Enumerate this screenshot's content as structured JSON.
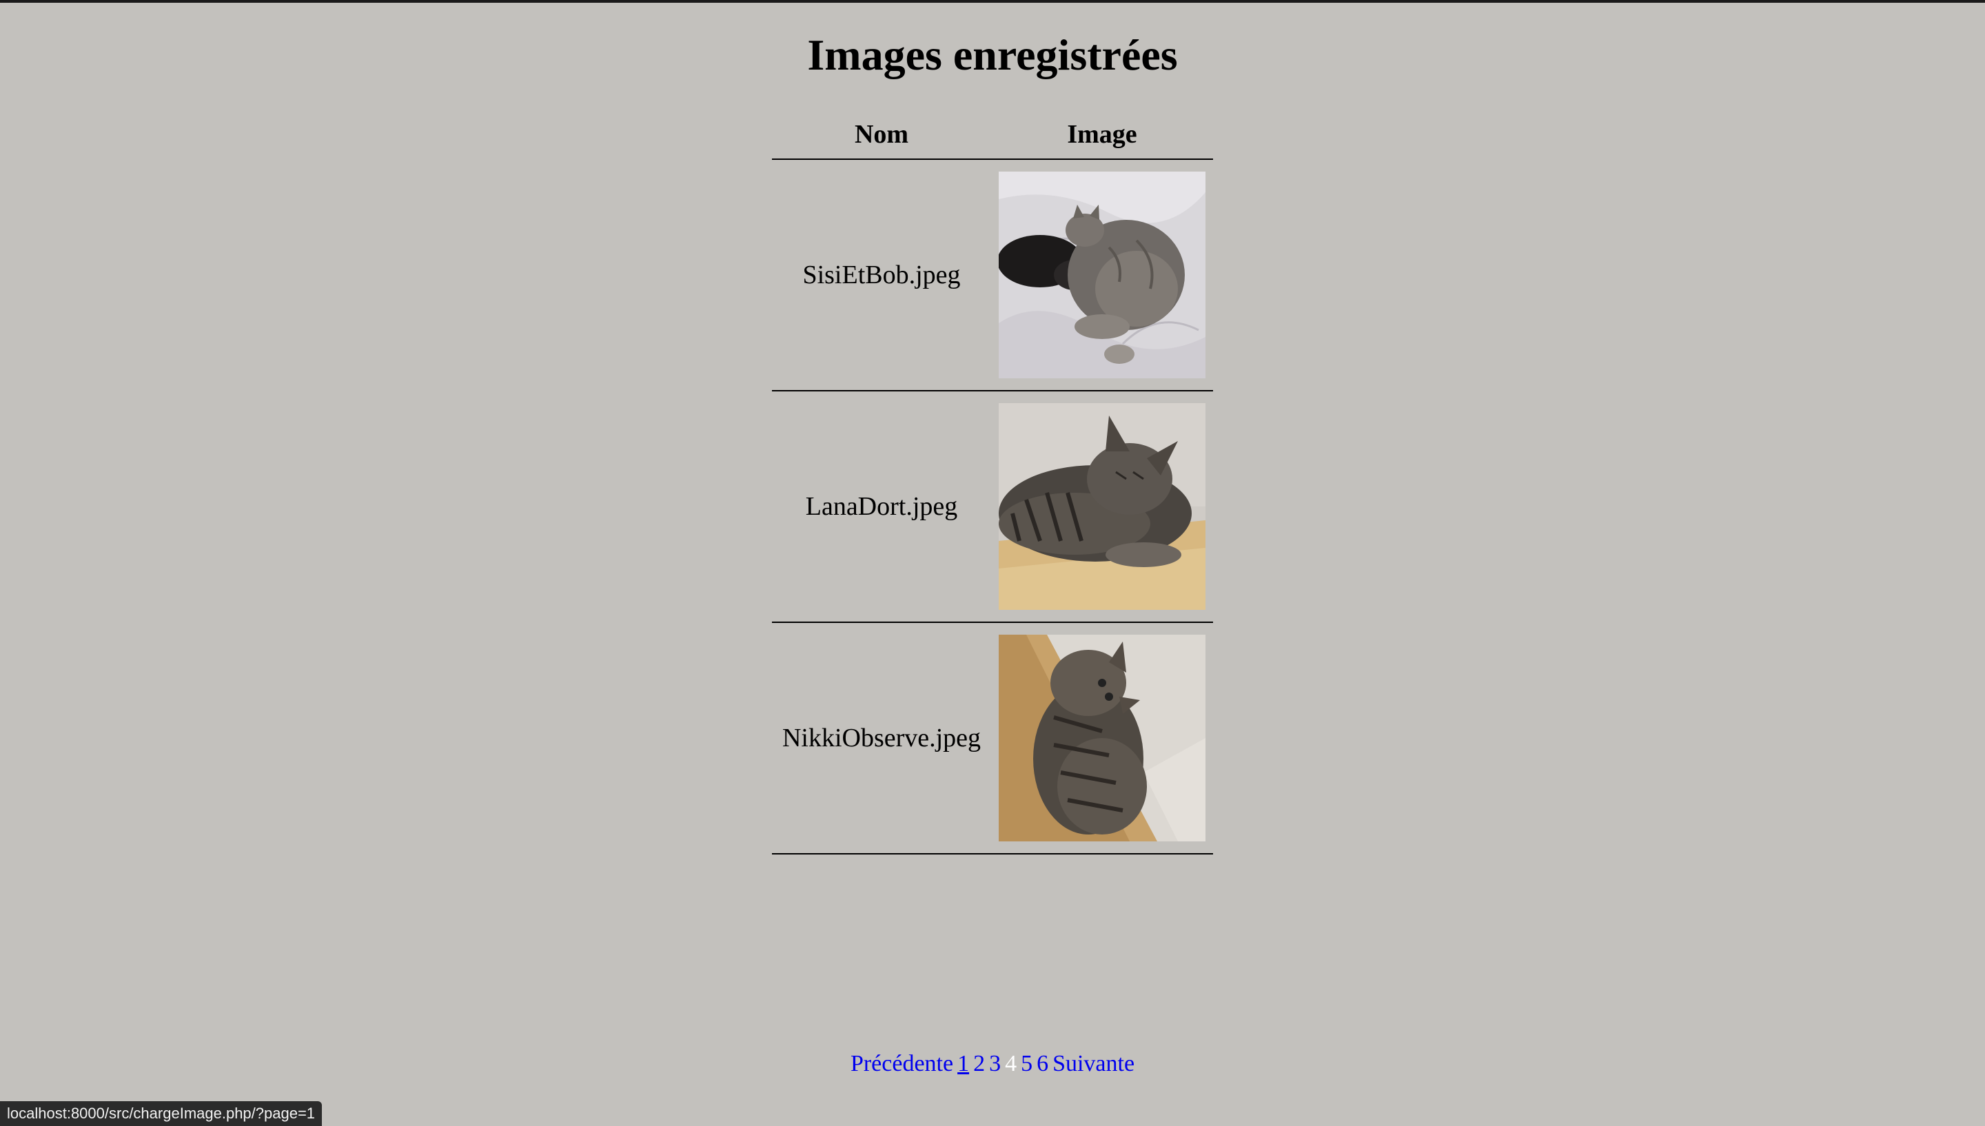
{
  "page": {
    "title": "Images enregistrées"
  },
  "table": {
    "headers": {
      "name": "Nom",
      "image": "Image"
    },
    "rows": [
      {
        "name": "SisiEtBob.jpeg",
        "image_desc": "cat-photo-gray-and-black-cats-on-white-sheet"
      },
      {
        "name": "LanaDort.jpeg",
        "image_desc": "cat-photo-tabby-sleeping-on-beige-couch"
      },
      {
        "name": "NikkiObserve.jpeg",
        "image_desc": "cat-photo-tabby-lying-by-white-wall"
      }
    ]
  },
  "pagination": {
    "previous": "Précédente",
    "pages": [
      "1",
      "2",
      "3",
      "4",
      "5",
      "6"
    ],
    "current_page": "4",
    "next": "Suivante"
  },
  "status_bar": {
    "url": "localhost:8000/src/chargeImage.php/?page=1"
  },
  "colors": {
    "background": "#c3c1bd",
    "link": "#0000ee",
    "current_page": "#ffffff"
  }
}
